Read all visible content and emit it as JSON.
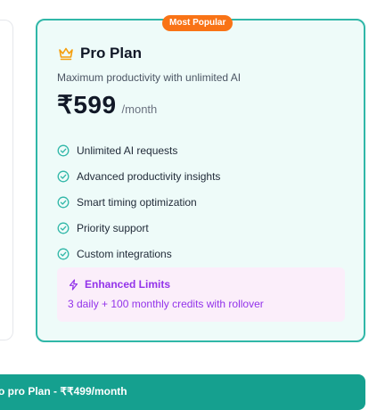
{
  "badge": "Most Popular",
  "plan": {
    "name": "Pro Plan",
    "subtitle": "Maximum productivity with unlimited AI",
    "price": "₹599",
    "period": "/month",
    "features": [
      "Unlimited AI requests",
      "Advanced productivity insights",
      "Smart timing optimization",
      "Priority support",
      "Custom integrations"
    ]
  },
  "limits": {
    "title": "Enhanced Limits",
    "description": "3 daily + 100 monthly credits with rollover"
  },
  "cta": {
    "label": "o pro Plan - ₹₹499/month"
  },
  "icons": {
    "crown": "crown-icon",
    "check": "check-circle-icon",
    "bolt": "zap-icon"
  },
  "colors": {
    "accent": "#30b7a8",
    "badge": "#f97316",
    "limits": "#9333ea",
    "cta": "#15a08f"
  }
}
